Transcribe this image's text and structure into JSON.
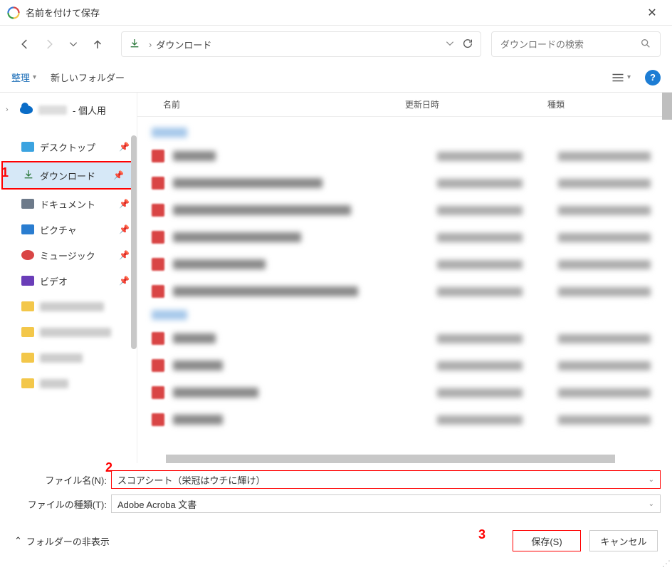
{
  "window": {
    "title": "名前を付けて保存"
  },
  "addressbar": {
    "location": "ダウンロード"
  },
  "search": {
    "placeholder": "ダウンロードの検索"
  },
  "toolbar": {
    "organize": "整理",
    "new_folder": "新しいフォルダー",
    "help": "?"
  },
  "sidebar": {
    "onedrive_suffix": "- 個人用",
    "items": [
      {
        "label": "デスクトップ"
      },
      {
        "label": "ダウンロード"
      },
      {
        "label": "ドキュメント"
      },
      {
        "label": "ピクチャ"
      },
      {
        "label": "ミュージック"
      },
      {
        "label": "ビデオ"
      }
    ]
  },
  "columns": {
    "name": "名前",
    "date": "更新日時",
    "type": "種類"
  },
  "form": {
    "filename_label": "ファイル名(N):",
    "filename_value": "スコアシート（栄冠はウチに輝け）",
    "filetype_label": "ファイルの種類(T):",
    "filetype_value": "Adobe Acroba 文書"
  },
  "footer": {
    "hide_folders": "フォルダーの非表示",
    "save": "保存(S)",
    "cancel": "キャンセル"
  },
  "annotations": {
    "a1": "1",
    "a2": "2",
    "a3": "3"
  }
}
